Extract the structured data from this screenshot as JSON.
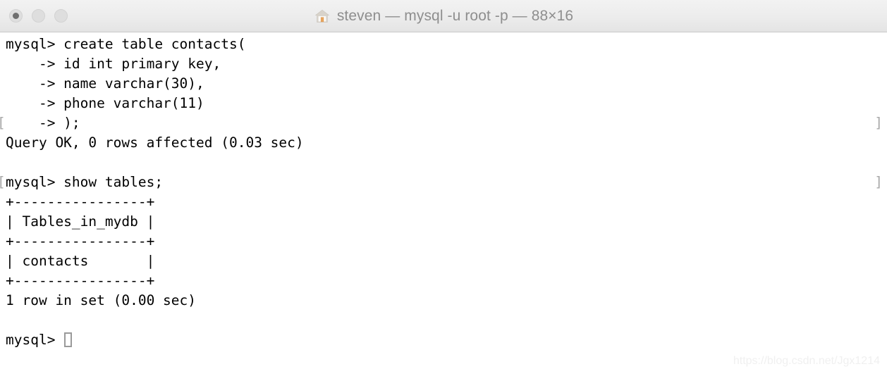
{
  "window": {
    "titlebar": {
      "title": "steven — mysql -u root -p — 88×16",
      "home_icon": "home-icon",
      "buttons": [
        {
          "name": "close-button",
          "label": "Close",
          "color": "#dedede",
          "has_dot": true
        },
        {
          "name": "minimize-button",
          "label": "Minimize",
          "color": "#dedede",
          "has_dot": false
        },
        {
          "name": "zoom-button",
          "label": "Zoom",
          "color": "#dedede",
          "has_dot": false
        }
      ]
    }
  },
  "terminal": {
    "columns": 88,
    "rows": 16,
    "prompt": "mysql> ",
    "continuation_prompt": "    -> ",
    "cursor": {
      "style": "hollow-block",
      "color": "#9a9a9a"
    },
    "colors": {
      "background": "#ffffff",
      "foreground": "#000000",
      "mark": "#a8a8a8"
    },
    "lines": [
      {
        "text": "mysql> create table contacts(",
        "mark_left": "",
        "mark_right": "",
        "cursor": false
      },
      {
        "text": "    -> id int primary key,",
        "mark_left": "",
        "mark_right": "",
        "cursor": false
      },
      {
        "text": "    -> name varchar(30),",
        "mark_left": "",
        "mark_right": "",
        "cursor": false
      },
      {
        "text": "    -> phone varchar(11)",
        "mark_left": "",
        "mark_right": "",
        "cursor": false
      },
      {
        "text": "    -> );",
        "mark_left": "[",
        "mark_right": "]",
        "cursor": false
      },
      {
        "text": "Query OK, 0 rows affected (0.03 sec)",
        "mark_left": "",
        "mark_right": "",
        "cursor": false
      },
      {
        "text": "",
        "mark_left": "",
        "mark_right": "",
        "cursor": false
      },
      {
        "text": "mysql> show tables;",
        "mark_left": "[",
        "mark_right": "]",
        "cursor": false
      },
      {
        "text": "+----------------+",
        "mark_left": "",
        "mark_right": "",
        "cursor": false
      },
      {
        "text": "| Tables_in_mydb |",
        "mark_left": "",
        "mark_right": "",
        "cursor": false
      },
      {
        "text": "+----------------+",
        "mark_left": "",
        "mark_right": "",
        "cursor": false
      },
      {
        "text": "| contacts       |",
        "mark_left": "",
        "mark_right": "",
        "cursor": false
      },
      {
        "text": "+----------------+",
        "mark_left": "",
        "mark_right": "",
        "cursor": false
      },
      {
        "text": "1 row in set (0.00 sec)",
        "mark_left": "",
        "mark_right": "",
        "cursor": false
      },
      {
        "text": "",
        "mark_left": "",
        "mark_right": "",
        "cursor": false
      },
      {
        "text": "mysql> ",
        "mark_left": "",
        "mark_right": "",
        "cursor": true
      }
    ],
    "result_table": {
      "headers": [
        "Tables_in_mydb"
      ],
      "rows": [
        [
          "contacts"
        ]
      ],
      "row_count_text": "1 row in set (0.00 sec)"
    },
    "statements": [
      "create table contacts( id int primary key, name varchar(30), phone varchar(11) );",
      "show tables;"
    ],
    "status_messages": [
      "Query OK, 0 rows affected (0.03 sec)",
      "1 row in set (0.00 sec)"
    ]
  },
  "watermark": {
    "text": "https://blog.csdn.net/Jgx1214"
  }
}
